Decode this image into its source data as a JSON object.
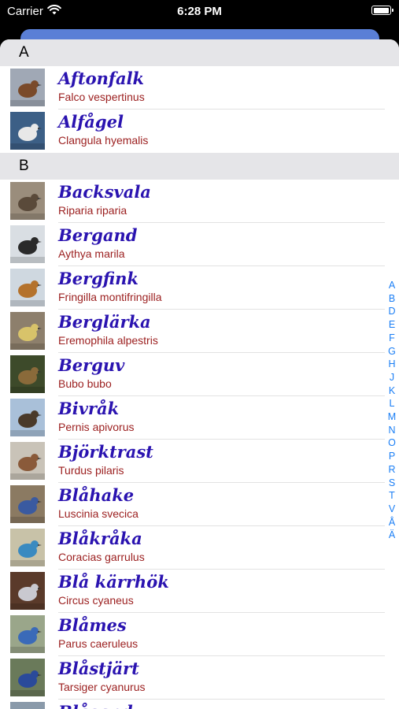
{
  "status_bar": {
    "carrier": "Carrier",
    "time": "6:28 PM"
  },
  "sections": [
    {
      "letter": "A",
      "birds": [
        {
          "name": "Aftonfalk",
          "latin": "Falco vespertinus",
          "thumb": {
            "bg": "#a0a8b5",
            "fg": "#7a4a2a"
          }
        },
        {
          "name": "Alfågel",
          "latin": "Clangula hyemalis",
          "thumb": {
            "bg": "#3c5f86",
            "fg": "#e8e8e8"
          }
        }
      ]
    },
    {
      "letter": "B",
      "birds": [
        {
          "name": "Backsvala",
          "latin": "Riparia riparia",
          "thumb": {
            "bg": "#9a8d7c",
            "fg": "#5a4a3a"
          }
        },
        {
          "name": "Bergand",
          "latin": "Aythya marila",
          "thumb": {
            "bg": "#d9dee3",
            "fg": "#2a2a2a"
          }
        },
        {
          "name": "Bergfink",
          "latin": "Fringilla montifringilla",
          "thumb": {
            "bg": "#cfd8e0",
            "fg": "#b4722c"
          }
        },
        {
          "name": "Berglärka",
          "latin": "Eremophila alpestris",
          "thumb": {
            "bg": "#8d7f6c",
            "fg": "#d8c36a"
          }
        },
        {
          "name": "Berguv",
          "latin": "Bubo bubo",
          "thumb": {
            "bg": "#3d4a2a",
            "fg": "#8a6a3a"
          }
        },
        {
          "name": "Bivråk",
          "latin": "Pernis apivorus",
          "thumb": {
            "bg": "#a9c0d9",
            "fg": "#4a3a2a"
          }
        },
        {
          "name": "Björktrast",
          "latin": "Turdus pilaris",
          "thumb": {
            "bg": "#c9c3b8",
            "fg": "#8a5a3a"
          }
        },
        {
          "name": "Blåhake",
          "latin": "Luscinia svecica",
          "thumb": {
            "bg": "#8b7a62",
            "fg": "#3a5aa0"
          }
        },
        {
          "name": "Blåkråka",
          "latin": "Coracias garrulus",
          "thumb": {
            "bg": "#c8c2a8",
            "fg": "#3a8ac0"
          }
        },
        {
          "name": "Blå kärrhök",
          "latin": "Circus cyaneus",
          "thumb": {
            "bg": "#5a3a2a",
            "fg": "#c9c9d0"
          }
        },
        {
          "name": "Blåmes",
          "latin": "Parus caeruleus",
          "thumb": {
            "bg": "#9aa68a",
            "fg": "#3a6ab8"
          }
        },
        {
          "name": "Blåstjärt",
          "latin": "Tarsiger cyanurus",
          "thumb": {
            "bg": "#6a7a5a",
            "fg": "#2a4a9a"
          }
        },
        {
          "name": "Blåsand",
          "latin": "",
          "thumb": {
            "bg": "#8a9aaa",
            "fg": "#5a5a5a"
          }
        }
      ]
    }
  ],
  "index_letters": [
    "A",
    "B",
    "D",
    "E",
    "F",
    "G",
    "H",
    "J",
    "K",
    "L",
    "M",
    "N",
    "O",
    "P",
    "R",
    "S",
    "T",
    "V",
    "Å",
    "Ä"
  ],
  "colors": {
    "accent": "#1a7ef5",
    "swedish_name": "#2a13b0",
    "latin_name": "#9b1e1e",
    "section_bg": "#e5e5e8"
  }
}
